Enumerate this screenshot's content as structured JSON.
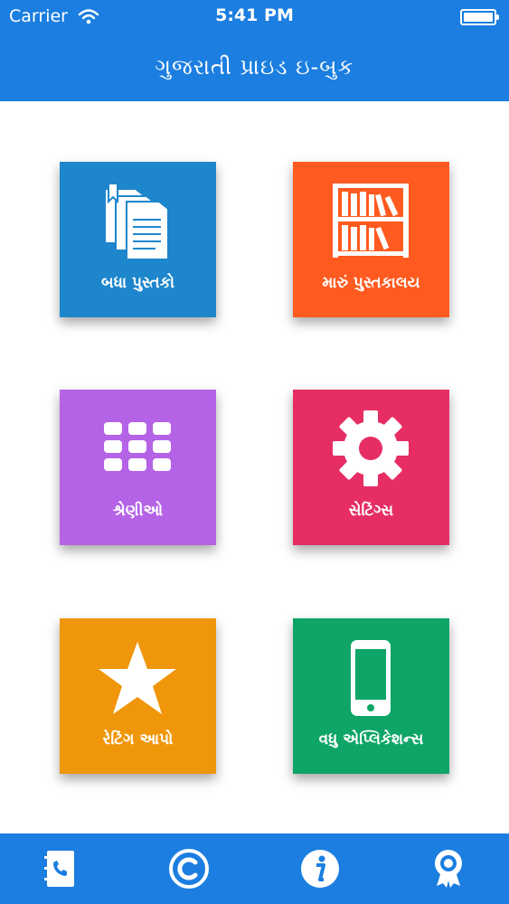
{
  "status_bar": {
    "carrier": "Carrier",
    "time": "5:41 PM"
  },
  "nav": {
    "title": "ગુજરાતી પ્રાઇડ ઇ-બુક"
  },
  "tiles": [
    {
      "label": "બધા પુસ્તકો",
      "color": "#1e86cc",
      "icon": "books-icon"
    },
    {
      "label": "મારું પુસ્તકાલય",
      "color": "#ff5a1f",
      "icon": "bookshelf-icon"
    },
    {
      "label": "શ્રેણીઓ",
      "color": "#b463e6",
      "icon": "grid-icon"
    },
    {
      "label": "સેટિંગ્સ",
      "color": "#e62d64",
      "icon": "gear-icon"
    },
    {
      "label": "રેટિંગ આપો",
      "color": "#f0960a",
      "icon": "star-icon"
    },
    {
      "label": "વધુ એપ્લિકેશન્સ",
      "color": "#0ea567",
      "icon": "phone-icon"
    }
  ],
  "tab_bar": {
    "accent": "#1b7ee0",
    "icons": [
      "contacts-book-icon",
      "copyright-icon",
      "info-icon",
      "award-ribbon-icon"
    ]
  }
}
